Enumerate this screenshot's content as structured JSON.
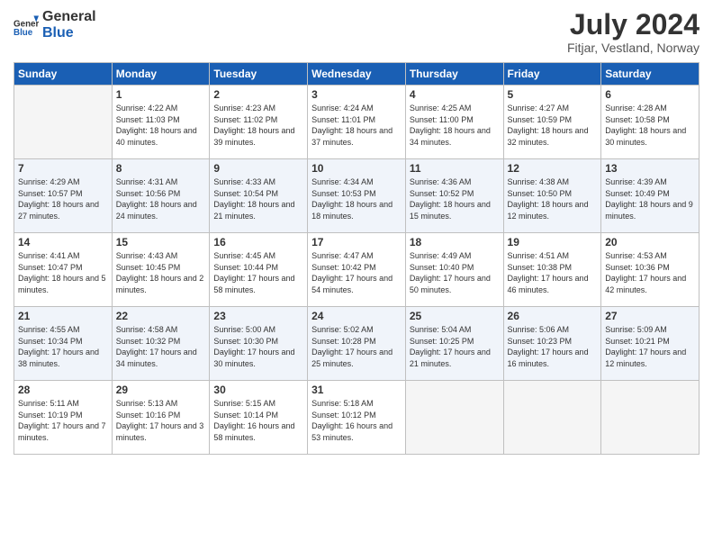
{
  "header": {
    "logo_general": "General",
    "logo_blue": "Blue",
    "month_title": "July 2024",
    "location": "Fitjar, Vestland, Norway"
  },
  "days_of_week": [
    "Sunday",
    "Monday",
    "Tuesday",
    "Wednesday",
    "Thursday",
    "Friday",
    "Saturday"
  ],
  "weeks": [
    [
      {
        "day": "",
        "sunrise": "",
        "sunset": "",
        "daylight": ""
      },
      {
        "day": "1",
        "sunrise": "4:22 AM",
        "sunset": "11:03 PM",
        "daylight": "18 hours and 40 minutes."
      },
      {
        "day": "2",
        "sunrise": "4:23 AM",
        "sunset": "11:02 PM",
        "daylight": "18 hours and 39 minutes."
      },
      {
        "day": "3",
        "sunrise": "4:24 AM",
        "sunset": "11:01 PM",
        "daylight": "18 hours and 37 minutes."
      },
      {
        "day": "4",
        "sunrise": "4:25 AM",
        "sunset": "11:00 PM",
        "daylight": "18 hours and 34 minutes."
      },
      {
        "day": "5",
        "sunrise": "4:27 AM",
        "sunset": "10:59 PM",
        "daylight": "18 hours and 32 minutes."
      },
      {
        "day": "6",
        "sunrise": "4:28 AM",
        "sunset": "10:58 PM",
        "daylight": "18 hours and 30 minutes."
      }
    ],
    [
      {
        "day": "7",
        "sunrise": "4:29 AM",
        "sunset": "10:57 PM",
        "daylight": "18 hours and 27 minutes."
      },
      {
        "day": "8",
        "sunrise": "4:31 AM",
        "sunset": "10:56 PM",
        "daylight": "18 hours and 24 minutes."
      },
      {
        "day": "9",
        "sunrise": "4:33 AM",
        "sunset": "10:54 PM",
        "daylight": "18 hours and 21 minutes."
      },
      {
        "day": "10",
        "sunrise": "4:34 AM",
        "sunset": "10:53 PM",
        "daylight": "18 hours and 18 minutes."
      },
      {
        "day": "11",
        "sunrise": "4:36 AM",
        "sunset": "10:52 PM",
        "daylight": "18 hours and 15 minutes."
      },
      {
        "day": "12",
        "sunrise": "4:38 AM",
        "sunset": "10:50 PM",
        "daylight": "18 hours and 12 minutes."
      },
      {
        "day": "13",
        "sunrise": "4:39 AM",
        "sunset": "10:49 PM",
        "daylight": "18 hours and 9 minutes."
      }
    ],
    [
      {
        "day": "14",
        "sunrise": "4:41 AM",
        "sunset": "10:47 PM",
        "daylight": "18 hours and 5 minutes."
      },
      {
        "day": "15",
        "sunrise": "4:43 AM",
        "sunset": "10:45 PM",
        "daylight": "18 hours and 2 minutes."
      },
      {
        "day": "16",
        "sunrise": "4:45 AM",
        "sunset": "10:44 PM",
        "daylight": "17 hours and 58 minutes."
      },
      {
        "day": "17",
        "sunrise": "4:47 AM",
        "sunset": "10:42 PM",
        "daylight": "17 hours and 54 minutes."
      },
      {
        "day": "18",
        "sunrise": "4:49 AM",
        "sunset": "10:40 PM",
        "daylight": "17 hours and 50 minutes."
      },
      {
        "day": "19",
        "sunrise": "4:51 AM",
        "sunset": "10:38 PM",
        "daylight": "17 hours and 46 minutes."
      },
      {
        "day": "20",
        "sunrise": "4:53 AM",
        "sunset": "10:36 PM",
        "daylight": "17 hours and 42 minutes."
      }
    ],
    [
      {
        "day": "21",
        "sunrise": "4:55 AM",
        "sunset": "10:34 PM",
        "daylight": "17 hours and 38 minutes."
      },
      {
        "day": "22",
        "sunrise": "4:58 AM",
        "sunset": "10:32 PM",
        "daylight": "17 hours and 34 minutes."
      },
      {
        "day": "23",
        "sunrise": "5:00 AM",
        "sunset": "10:30 PM",
        "daylight": "17 hours and 30 minutes."
      },
      {
        "day": "24",
        "sunrise": "5:02 AM",
        "sunset": "10:28 PM",
        "daylight": "17 hours and 25 minutes."
      },
      {
        "day": "25",
        "sunrise": "5:04 AM",
        "sunset": "10:25 PM",
        "daylight": "17 hours and 21 minutes."
      },
      {
        "day": "26",
        "sunrise": "5:06 AM",
        "sunset": "10:23 PM",
        "daylight": "17 hours and 16 minutes."
      },
      {
        "day": "27",
        "sunrise": "5:09 AM",
        "sunset": "10:21 PM",
        "daylight": "17 hours and 12 minutes."
      }
    ],
    [
      {
        "day": "28",
        "sunrise": "5:11 AM",
        "sunset": "10:19 PM",
        "daylight": "17 hours and 7 minutes."
      },
      {
        "day": "29",
        "sunrise": "5:13 AM",
        "sunset": "10:16 PM",
        "daylight": "17 hours and 3 minutes."
      },
      {
        "day": "30",
        "sunrise": "5:15 AM",
        "sunset": "10:14 PM",
        "daylight": "16 hours and 58 minutes."
      },
      {
        "day": "31",
        "sunrise": "5:18 AM",
        "sunset": "10:12 PM",
        "daylight": "16 hours and 53 minutes."
      },
      {
        "day": "",
        "sunrise": "",
        "sunset": "",
        "daylight": ""
      },
      {
        "day": "",
        "sunrise": "",
        "sunset": "",
        "daylight": ""
      },
      {
        "day": "",
        "sunrise": "",
        "sunset": "",
        "daylight": ""
      }
    ]
  ],
  "labels": {
    "sunrise_prefix": "Sunrise: ",
    "sunset_prefix": "Sunset: ",
    "daylight_prefix": "Daylight: "
  }
}
